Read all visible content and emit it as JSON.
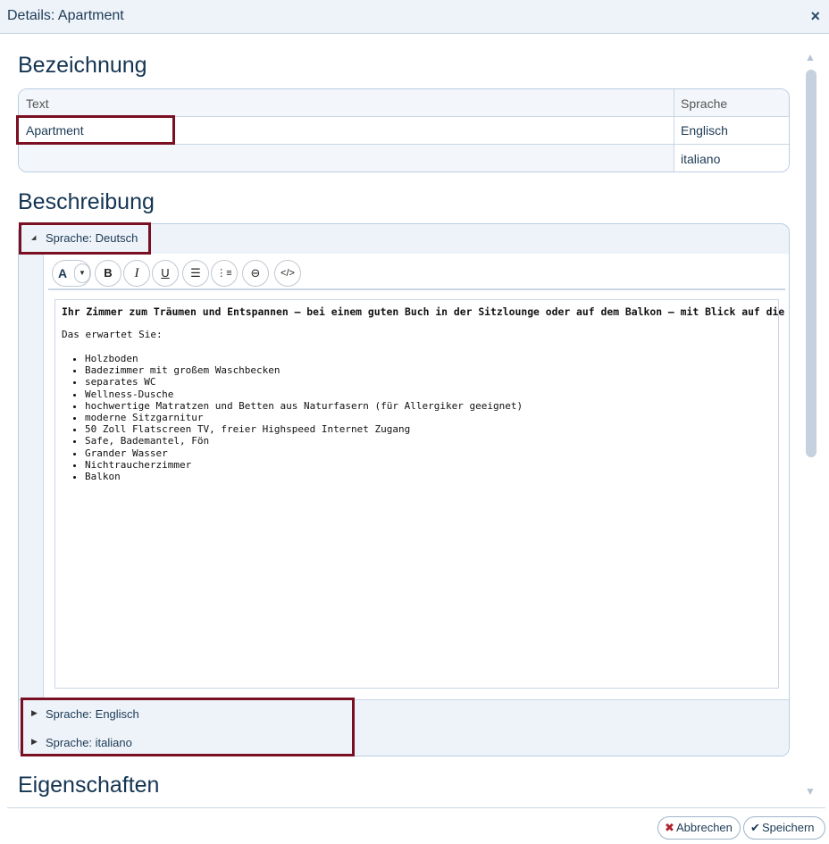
{
  "window": {
    "title": "Details: Apartment",
    "close_label": "×"
  },
  "sections": {
    "bezeichnung": "Bezeichnung",
    "beschreibung": "Beschreibung",
    "eigenschaften": "Eigenschaften"
  },
  "grid": {
    "headers": {
      "text": "Text",
      "language": "Sprache"
    },
    "rows": [
      {
        "text": "Apartment",
        "language": "Englisch"
      },
      {
        "text": "",
        "language": "italiano"
      }
    ]
  },
  "description": {
    "expanded": {
      "label": "Sprache: Deutsch",
      "arrow": "◢"
    },
    "collapsed": [
      {
        "label": "Sprache: Englisch",
        "arrow": "▶"
      },
      {
        "label": "Sprache: italiano",
        "arrow": "▶"
      }
    ],
    "toolbar": {
      "font": "A",
      "font_dropdown": "▼",
      "bold": "B",
      "italic": "I",
      "underline": "U",
      "bullet_list": "☰",
      "numbered_list": "⋮≡",
      "link": "⊖",
      "code": "</>"
    },
    "content": {
      "headline": "Ihr Zimmer zum Träumen und Entspannen – bei einem guten Buch in der Sitzlounge oder auf dem Balkon – mit Blick auf die Berge.",
      "intro": "Das erwartet Sie:",
      "items": [
        "Holzboden",
        "Badezimmer mit großem Waschbecken",
        "separates WC",
        "Wellness-Dusche",
        "hochwertige Matratzen und Betten aus Naturfasern (für Allergiker geeignet)",
        "moderne Sitzgarnitur",
        "50 Zoll Flatscreen TV, freier Highspeed Internet Zugang",
        "Safe, Bademantel, Fön",
        "Grander Wasser",
        "Nichtraucherzimmer",
        "Balkon"
      ]
    }
  },
  "scrollbar": {
    "up": "▲",
    "down": "▼"
  },
  "footer": {
    "cancel": {
      "icon": "✖",
      "label": "Abbrechen"
    },
    "save": {
      "icon": "✔",
      "label": "Speichern"
    }
  },
  "colors": {
    "highlight": "#7a0f22",
    "accent": "#1c3a55",
    "panel_bg": "#eef3f9",
    "border": "#b9cde3"
  }
}
